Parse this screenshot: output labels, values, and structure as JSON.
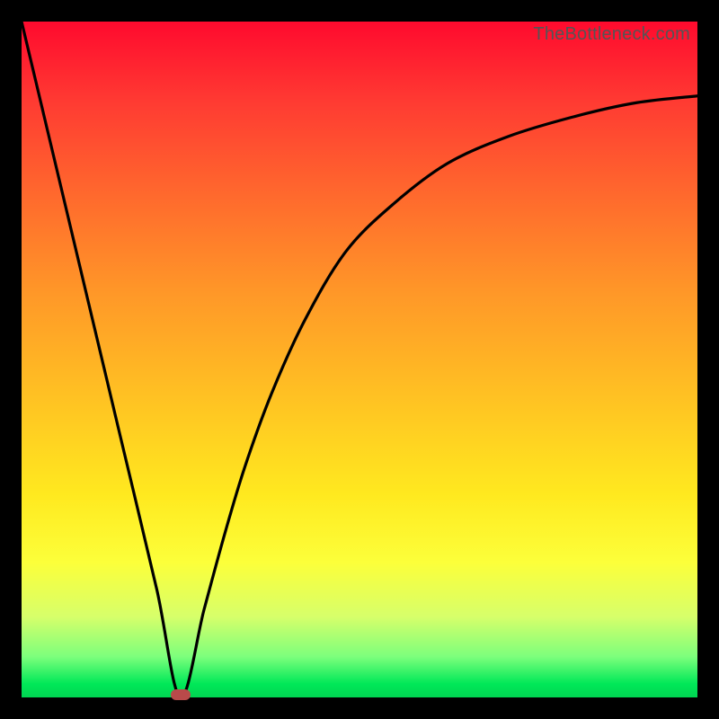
{
  "watermark": "TheBottleneck.com",
  "colors": {
    "page_bg": "#000000",
    "curve_stroke": "#000000",
    "marker_fill": "#b94a4a"
  },
  "chart_data": {
    "type": "line",
    "title": "",
    "xlabel": "",
    "ylabel": "",
    "xlim": [
      0,
      1
    ],
    "ylim": [
      0,
      1
    ],
    "grid": false,
    "legend": false,
    "series": [
      {
        "name": "bottleneck-curve",
        "x": [
          0.0,
          0.05,
          0.1,
          0.15,
          0.2,
          0.235,
          0.27,
          0.3,
          0.33,
          0.37,
          0.42,
          0.48,
          0.55,
          0.63,
          0.72,
          0.82,
          0.91,
          1.0
        ],
        "y": [
          1.0,
          0.79,
          0.58,
          0.37,
          0.16,
          0.0,
          0.13,
          0.24,
          0.34,
          0.45,
          0.56,
          0.66,
          0.73,
          0.79,
          0.83,
          0.86,
          0.88,
          0.89
        ]
      }
    ],
    "annotations": [
      {
        "name": "min-marker",
        "x": 0.235,
        "y": 0.0
      }
    ]
  }
}
